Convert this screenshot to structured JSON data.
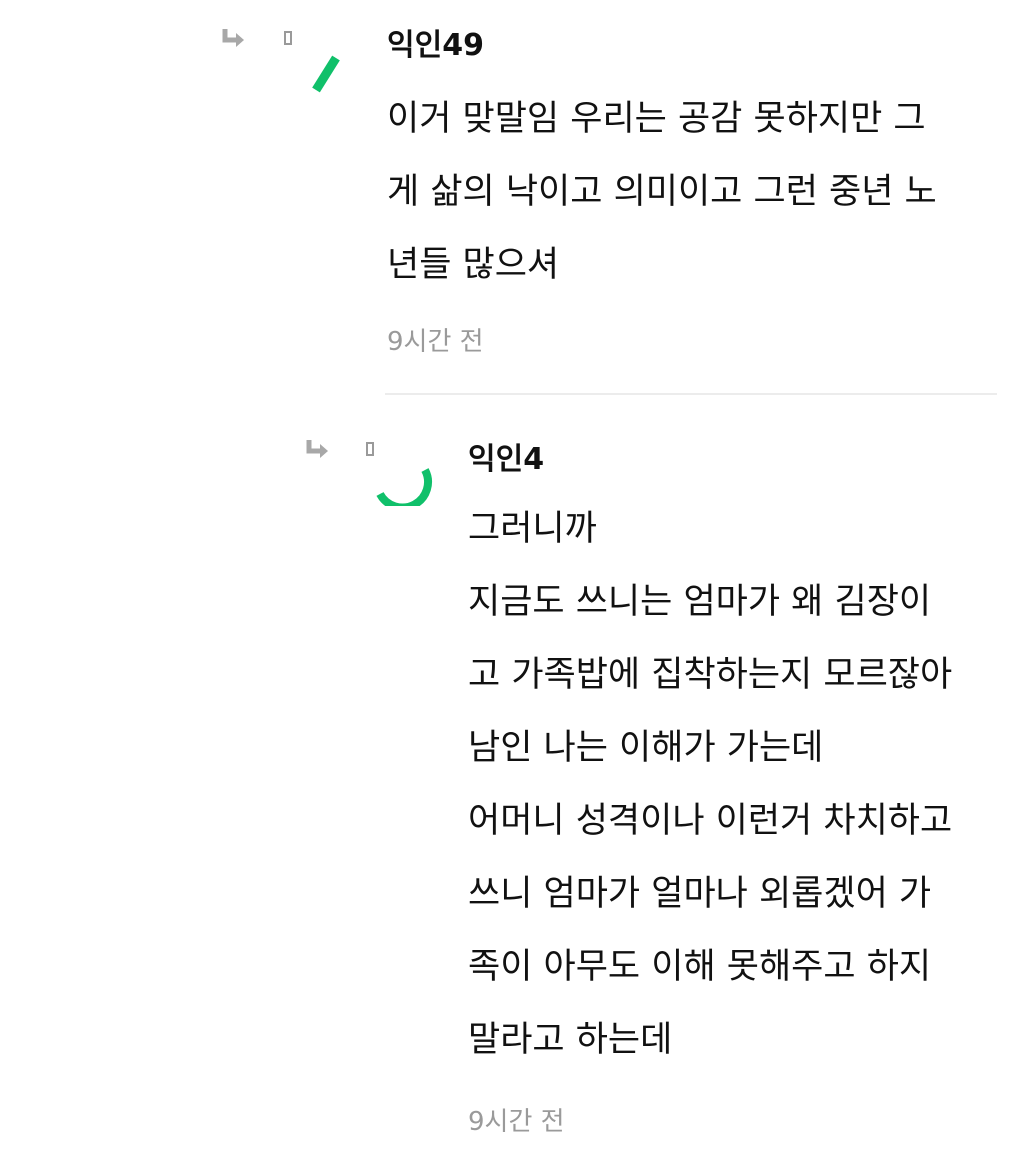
{
  "comments": [
    {
      "author": "익인49",
      "lines": [
        "이거 맞말임 우리는 공감 못하지만 그",
        "게 삶의 낙이고 의미이고 그런 중년 노",
        "년들 많으셔"
      ],
      "time": "9시간 전",
      "icons": {
        "reply": "reply-arrow-icon",
        "placeholder": "placeholder-glyph-icon",
        "avatar": "avatar-loading-icon"
      }
    },
    {
      "author": "익인4",
      "lines": [
        "그러니까",
        "지금도 쓰니는 엄마가 왜 김장이",
        "고 가족밥에 집착하는지 모르잖아",
        "남인 나는 이해가 가는데",
        "어머니 성격이나 이런거 차치하고",
        "쓰니 엄마가 얼마나 외롭겠어 가",
        "족이 아무도 이해 못해주고 하지",
        "말라고 하는데"
      ],
      "time": "9시간 전",
      "icons": {
        "reply": "reply-arrow-icon",
        "placeholder": "placeholder-glyph-icon",
        "avatar": "avatar-loading-icon"
      }
    }
  ],
  "colors": {
    "avatar_spinner": "#10c06a",
    "reply_icon": "#a8a8a8",
    "time_text": "#9a9a9a",
    "divider": "#ececec"
  }
}
